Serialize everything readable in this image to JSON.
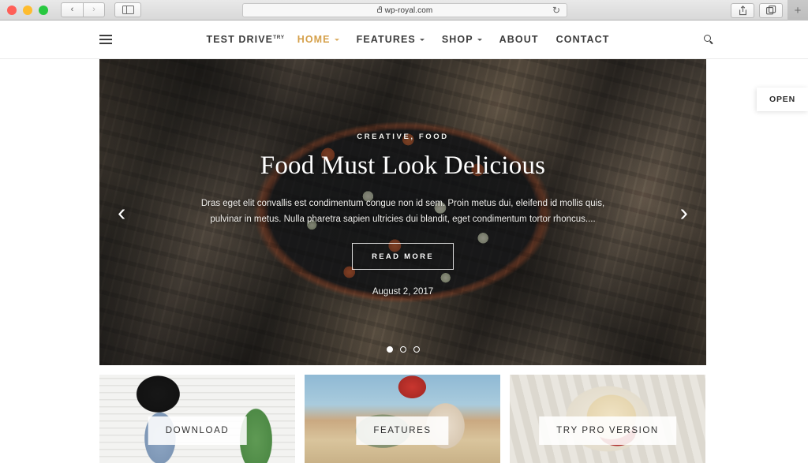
{
  "browser": {
    "url": "wp-royal.com",
    "back_label": "‹",
    "forward_label": "›",
    "sidebar_label": "sidebar-toggle",
    "reload_label": "↻",
    "share_label": "share",
    "tabs_label": "tabs",
    "new_tab_label": "+"
  },
  "header": {
    "menu_icon": "hamburger-icon",
    "brand": "TEST DRIVE",
    "brand_sup": "TRY",
    "search_icon": "search-icon",
    "nav": [
      {
        "label": "HOME",
        "has_caret": true,
        "active": true
      },
      {
        "label": "FEATURES",
        "has_caret": true,
        "active": false
      },
      {
        "label": "SHOP",
        "has_caret": true,
        "active": false
      },
      {
        "label": "ABOUT",
        "has_caret": false,
        "active": false
      },
      {
        "label": "CONTACT",
        "has_caret": false,
        "active": false
      }
    ]
  },
  "hero": {
    "categories": "CREATIVE, FOOD",
    "title": "Food Must Look Delicious",
    "excerpt": "Dras eget elit convallis est condimentum congue non id sem. Proin metus dui, eleifend id mollis quis, pulvinar in metus. Nulla pharetra sapien ultricies dui blandit, eget condimentum tortor rhoncus....",
    "button_label": "READ MORE",
    "date": "August 2, 2017",
    "prev_arrow": "‹",
    "next_arrow": "›",
    "slide_count": 3,
    "active_slide": 1
  },
  "cards": [
    {
      "label": "DOWNLOAD"
    },
    {
      "label": "FEATURES"
    },
    {
      "label": "TRY PRO VERSION"
    }
  ],
  "open_tab": {
    "label": "OPEN"
  },
  "colors": {
    "accent": "#d5a04a",
    "text": "#3b3b3b",
    "page_bg": "#ffffff"
  }
}
